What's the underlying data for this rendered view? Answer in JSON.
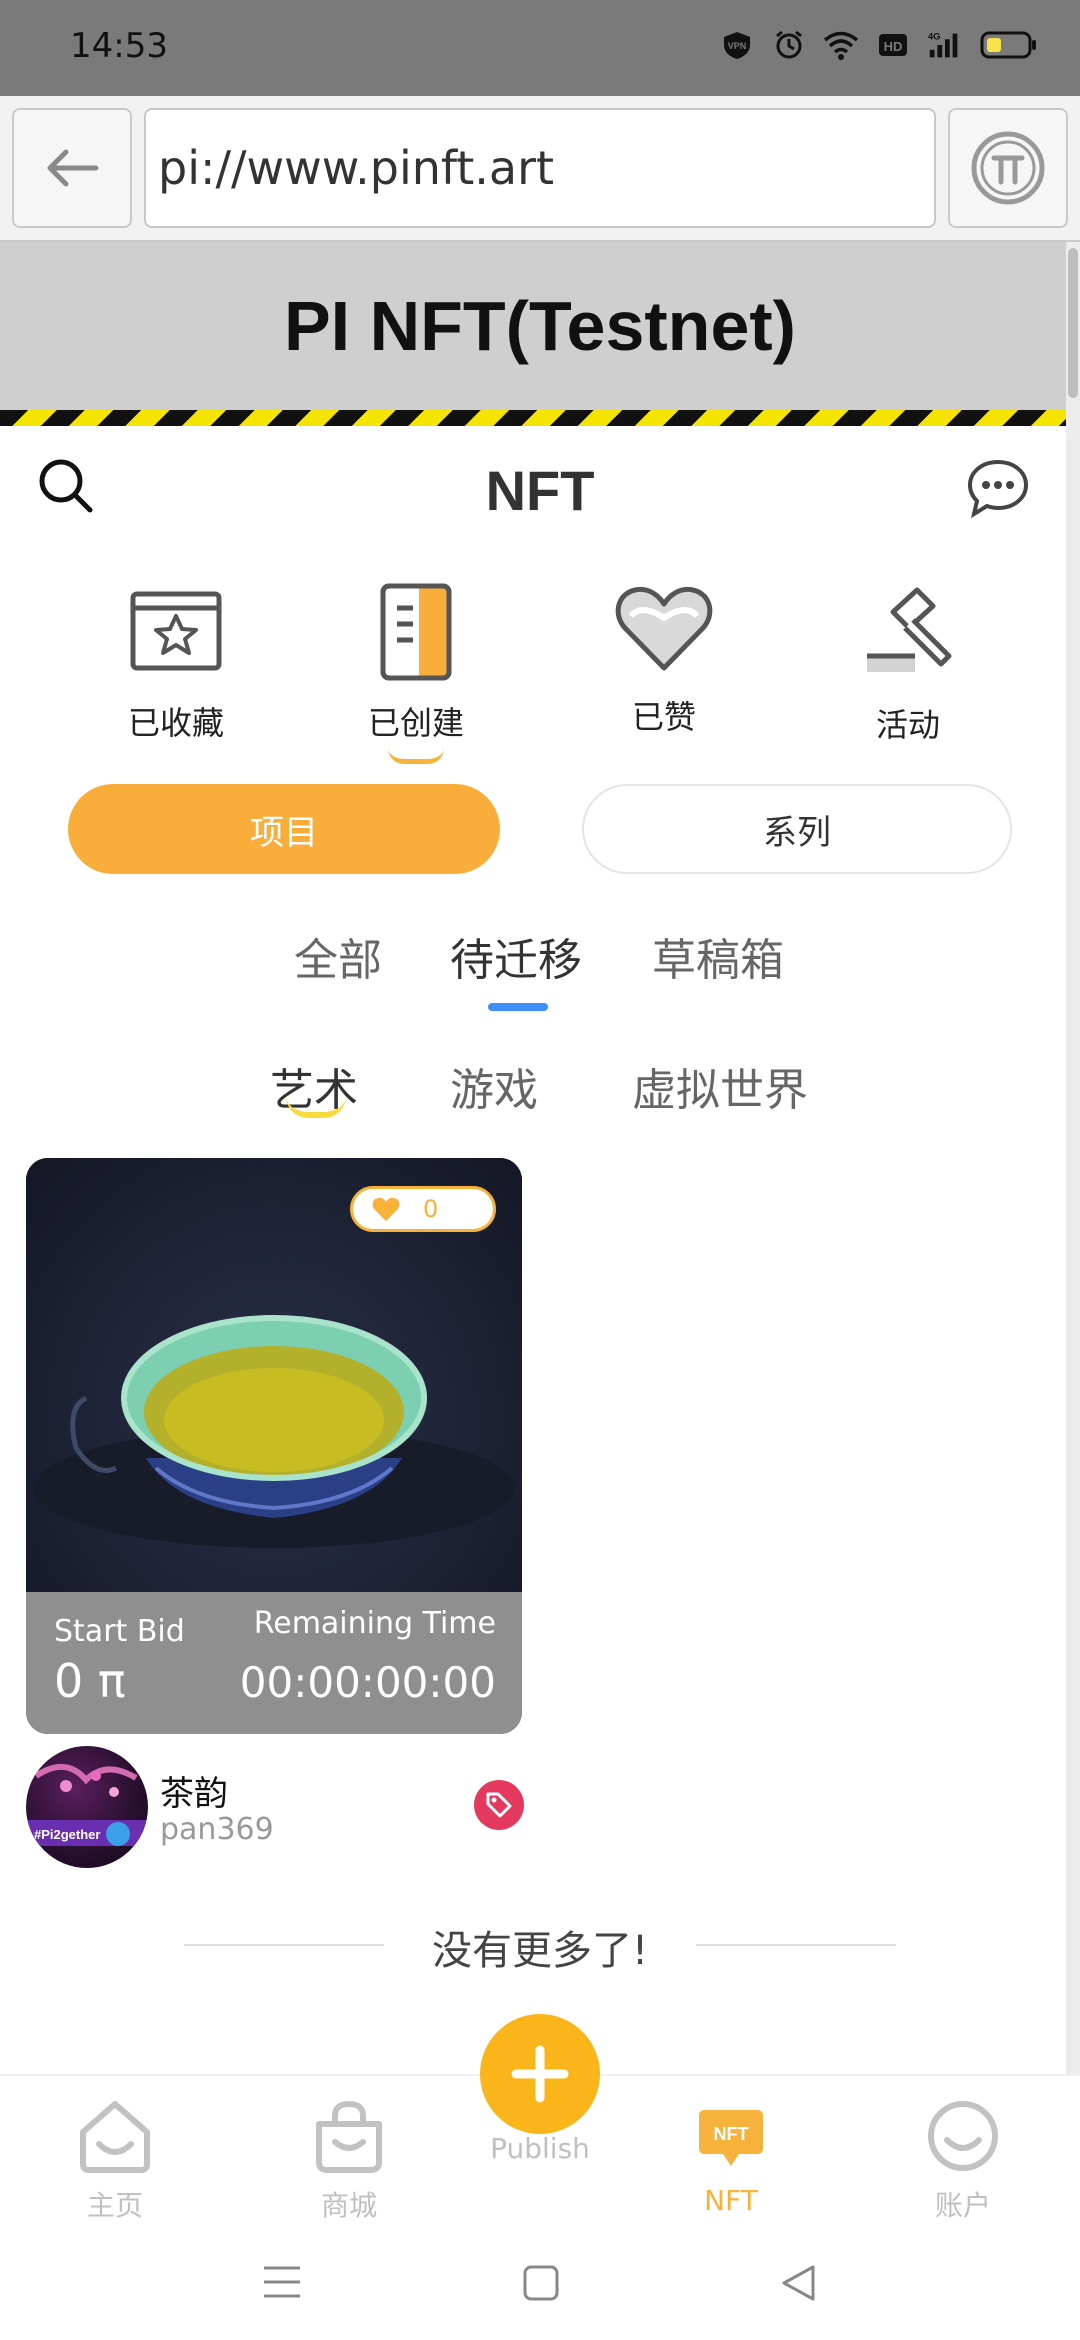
{
  "status_bar": {
    "time": "14:53",
    "icons": [
      "vpn-icon",
      "alarm-icon",
      "wifi-icon",
      "hd-icon",
      "signal-4g-icon",
      "battery-icon"
    ],
    "hd_label": "HD",
    "net_label": "4G"
  },
  "browser": {
    "url": "pi://www.pinft.art"
  },
  "banner": {
    "title": "PI NFT(Testnet)"
  },
  "header": {
    "title": "NFT"
  },
  "categories": [
    {
      "label": "已收藏",
      "icon": "star-folder-icon"
    },
    {
      "label": "已创建",
      "icon": "notebook-icon"
    },
    {
      "label": "已赞",
      "icon": "heart-icon"
    },
    {
      "label": "活动",
      "icon": "auction-hammer-icon"
    }
  ],
  "toggle": {
    "active": "项目",
    "inactive": "系列"
  },
  "tabs": [
    "全部",
    "待迁移",
    "草稿箱"
  ],
  "active_tab_index": 1,
  "subtabs": [
    "艺术",
    "游戏",
    "虚拟世界"
  ],
  "active_subtab_index": 0,
  "nft_card": {
    "likes": "0",
    "bid_label": "Start Bid",
    "bid_value": "0 π",
    "time_label": "Remaining Time",
    "time_value": "00:00:00:00",
    "creator_name": "茶韵",
    "creator_handle": "pan369",
    "avatar_text": "#Pi2gether"
  },
  "no_more": "没有更多了!",
  "bottom_nav": [
    {
      "label": "主页",
      "icon": "home-icon"
    },
    {
      "label": "商城",
      "icon": "shop-bag-icon"
    },
    {
      "label": "Publish",
      "icon": "plus-icon"
    },
    {
      "label": "NFT",
      "icon": "nft-icon",
      "active": true
    },
    {
      "label": "账户",
      "icon": "account-icon"
    }
  ],
  "nft_icon_text": "NFT",
  "colors": {
    "accent": "#f9ad3a",
    "tab_indicator": "#3d8ff6",
    "tag": "#e4395e",
    "status_bar": "#7a7a7a"
  }
}
